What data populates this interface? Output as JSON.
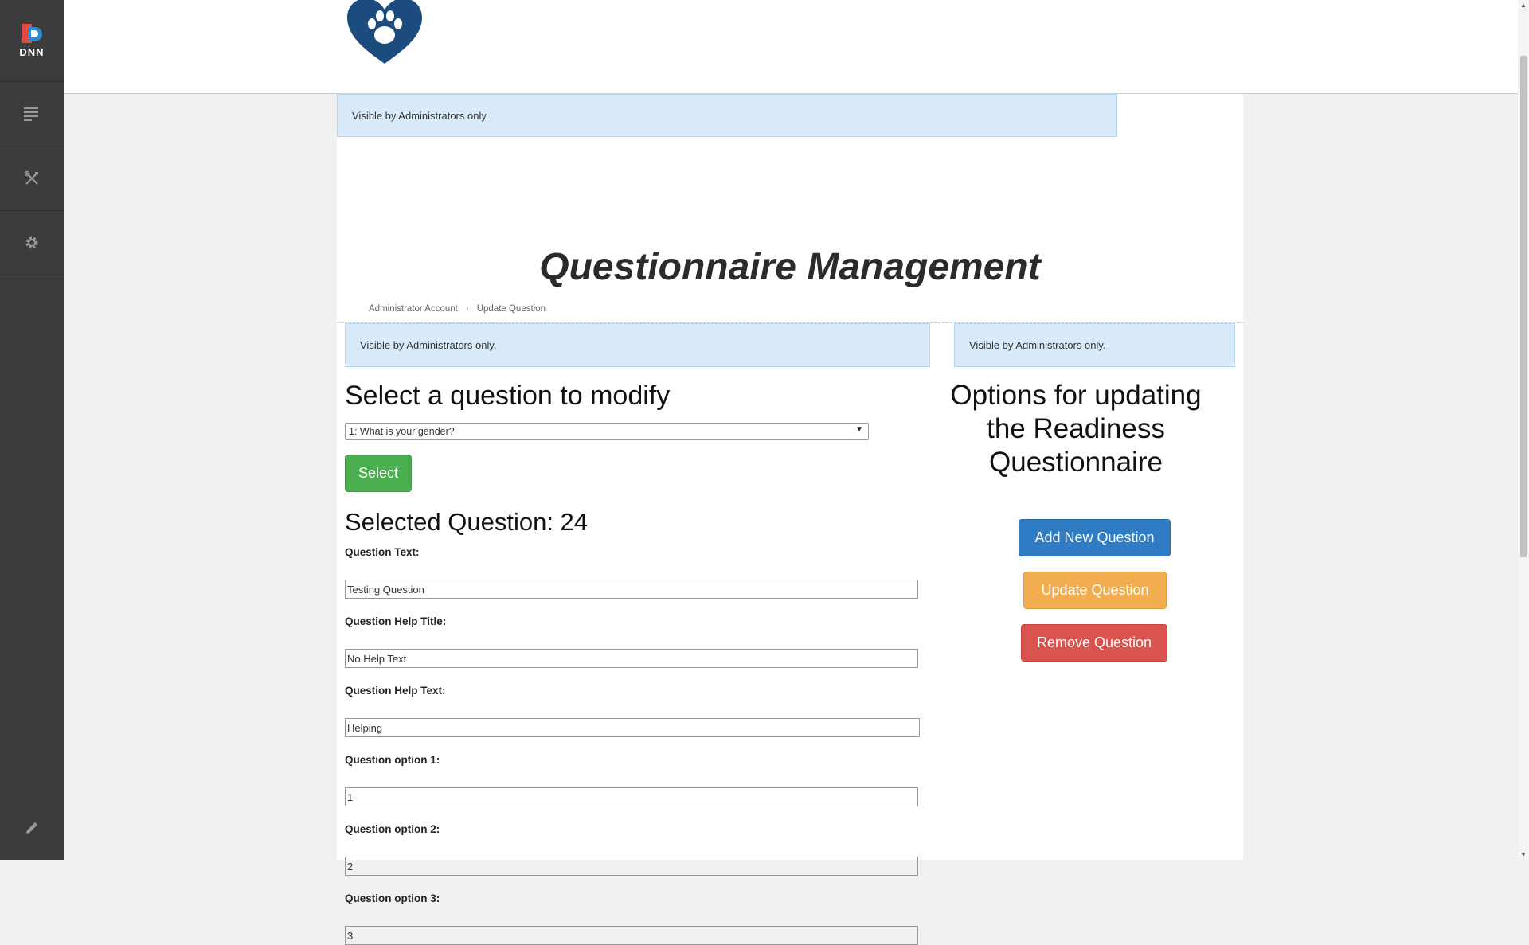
{
  "persona_bar": {
    "logo_text": "DNN",
    "items": [
      {
        "icon": "content-icon"
      },
      {
        "icon": "manage-tools-icon"
      },
      {
        "icon": "settings-gear-icon"
      }
    ],
    "bottom_icon": "edit-pencil-icon",
    "colors": {
      "background": "#3d3c3c",
      "logo_red": "#e7483f",
      "logo_blue": "#2e8bd0"
    }
  },
  "header": {
    "logo_icon": "heart-paw-logo",
    "logo_color": "#1c4b7e"
  },
  "admin_notes": {
    "top": "Visible by Administrators only.",
    "left": "Visible by Administrators only.",
    "right": "Visible by Administrators only."
  },
  "page": {
    "title": "Questionnaire Management"
  },
  "breadcrumb": {
    "items": [
      "Administrator Account",
      "Update Question"
    ],
    "separator": "›"
  },
  "left_panel": {
    "heading": "Select a question to modify",
    "question_select": {
      "selected": "1: What is your gender?"
    },
    "select_button": "Select",
    "selected_question_heading": "Selected Question: 24",
    "fields": [
      {
        "label": "Question Text:",
        "value": "Testing Question"
      },
      {
        "label": "Question Help Title:",
        "value": "No Help Text"
      },
      {
        "label": "Question Help Text:",
        "value": "Helping"
      },
      {
        "label": "Question option 1:",
        "value": "1"
      },
      {
        "label": "Question option 2:",
        "value": "2"
      },
      {
        "label": "Question option 3:",
        "value": "3"
      }
    ]
  },
  "right_panel": {
    "heading": "Options for updating the Readiness Questionnaire",
    "buttons": {
      "add": "Add New Question",
      "update": "Update Question",
      "remove": "Remove Question"
    },
    "colors": {
      "add": "#2f7bc4",
      "update": "#f1ad4e",
      "remove": "#d9534f",
      "select": "#4bae4f"
    }
  }
}
